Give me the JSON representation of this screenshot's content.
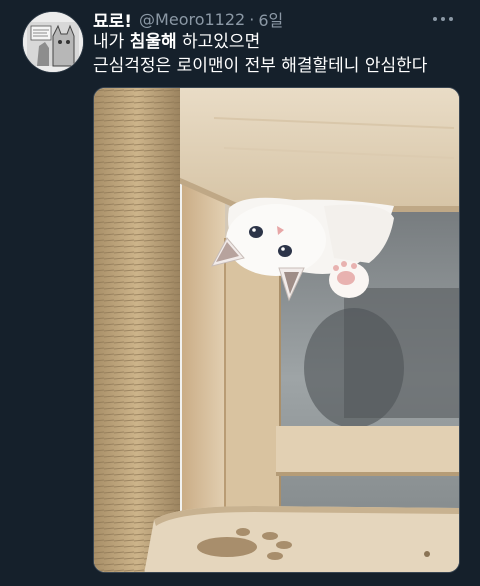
{
  "tweet": {
    "author": {
      "display_name": "묘로!",
      "handle": "@Meoro1122",
      "separator": "·",
      "time_ago": "6일"
    },
    "text": {
      "line1_before": "내가 ",
      "line1_bold": "침울해",
      "line1_after": " 하고있으면",
      "line2": "근심걱정은 로이맨이 전부 해결할테니 안심한다"
    },
    "media": {
      "description_icon": "photo"
    },
    "icons": {
      "more": "more-horizontal-icon",
      "avatar": "profile-avatar"
    },
    "colors": {
      "background": "#15202b",
      "primary_text": "#ffffff",
      "secondary_text": "#8b98a5"
    }
  }
}
